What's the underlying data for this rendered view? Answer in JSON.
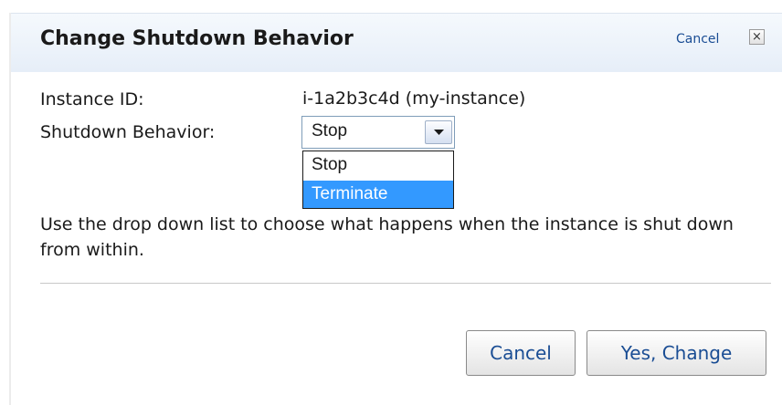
{
  "dialog": {
    "title": "Change Shutdown Behavior",
    "header_cancel_label": "Cancel",
    "close_icon": "close-icon",
    "close_glyph": "×"
  },
  "fields": {
    "instance_id_label": "Instance ID:",
    "instance_id_value": "i-1a2b3c4d (my-instance)",
    "shutdown_behavior_label": "Shutdown Behavior:",
    "shutdown_behavior_selected": "Stop"
  },
  "dropdown": {
    "options": [
      {
        "label": "Stop",
        "highlighted": false
      },
      {
        "label": "Terminate",
        "highlighted": true
      }
    ],
    "highlight_color": "#3399ff"
  },
  "help_text": "Use the drop down list to choose what happens when the instance is shut down from within.",
  "buttons": {
    "cancel_label": "Cancel",
    "confirm_label": "Yes, Change"
  },
  "colors": {
    "link": "#1a4d94",
    "header_bg": "#e6eef8"
  }
}
